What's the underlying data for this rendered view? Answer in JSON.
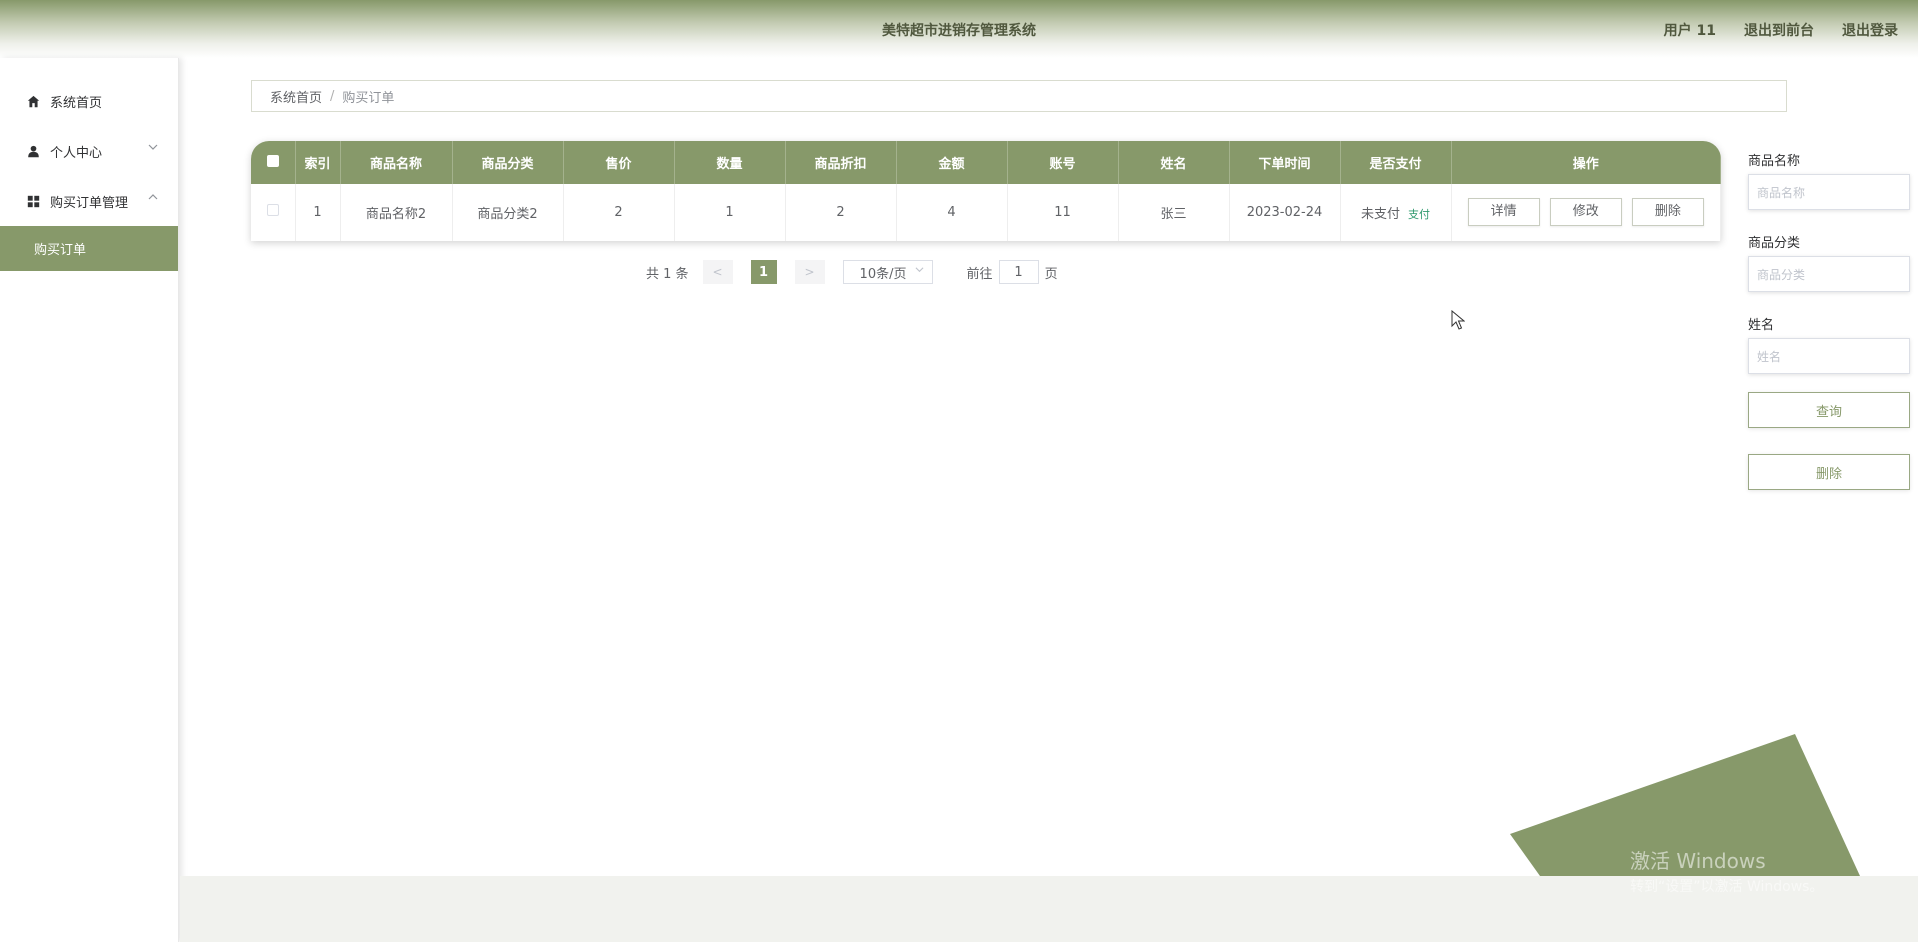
{
  "header": {
    "title": "美特超市进销存管理系统",
    "user": "用户 11",
    "exit_front": "退出到前台",
    "logout": "退出登录"
  },
  "sidebar": {
    "items": [
      {
        "label": "系统首页",
        "icon": "home-icon"
      },
      {
        "label": "个人中心",
        "icon": "user-icon",
        "chevron": "down"
      },
      {
        "label": "购买订单管理",
        "icon": "grid-icon",
        "chevron": "up"
      }
    ],
    "submenu": {
      "label": "购买订单"
    }
  },
  "breadcrumb": {
    "home": "系统首页",
    "separator": "/",
    "current": "购买订单"
  },
  "table": {
    "columns": [
      "索引",
      "商品名称",
      "商品分类",
      "售价",
      "数量",
      "商品折扣",
      "金额",
      "账号",
      "姓名",
      "下单时间",
      "是否支付",
      "操作"
    ],
    "rows": [
      {
        "index": "1",
        "name": "商品名称2",
        "category": "商品分类2",
        "price": "2",
        "qty": "1",
        "discount": "2",
        "amount": "4",
        "account": "11",
        "person": "张三",
        "time": "2023-02-24",
        "paid": "未支付",
        "pay_link": "支付"
      }
    ],
    "actions": {
      "detail": "详情",
      "edit": "修改",
      "delete": "删除"
    }
  },
  "pagination": {
    "total": "共 1 条",
    "prev": "<",
    "page": "1",
    "next": ">",
    "page_size": "10条/页",
    "goto_prefix": "前往",
    "goto_value": "1",
    "goto_suffix": "页"
  },
  "search": {
    "name_label": "商品名称",
    "name_placeholder": "商品名称",
    "category_label": "商品分类",
    "category_placeholder": "商品分类",
    "person_label": "姓名",
    "person_placeholder": "姓名",
    "query_button": "查询",
    "delete_button": "删除"
  },
  "watermark": {
    "line1": "激活 Windows",
    "line2": "转到“设置”以激活 Windows。"
  },
  "colors": {
    "accent": "#87996a",
    "pay_link": "#2e9a6e"
  }
}
